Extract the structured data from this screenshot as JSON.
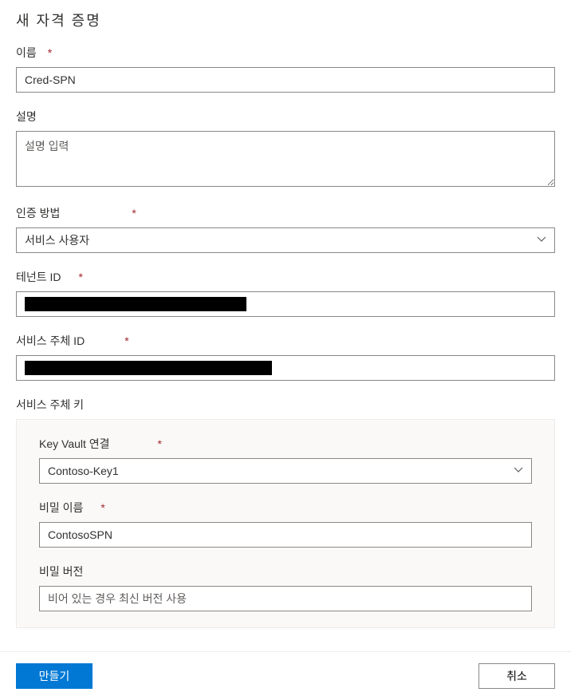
{
  "page": {
    "title": "새 자격 증명"
  },
  "fields": {
    "name": {
      "label": "이름",
      "value": "Cred-SPN",
      "required": true
    },
    "description": {
      "label": "설명",
      "placeholder": "설명 입력",
      "value": ""
    },
    "auth_method": {
      "label": "인증 방법",
      "value": "서비스 사용자",
      "required": true
    },
    "tenant_id": {
      "label": "테넌트 ID",
      "required": true,
      "redacted": true
    },
    "sp_id": {
      "label": "서비스 주체 ID",
      "required": true,
      "redacted": true
    },
    "sp_key": {
      "section_label": "서비스 주체 키",
      "kv_connection": {
        "label": "Key Vault 연결",
        "value": "Contoso-Key1",
        "required": true
      },
      "secret_name": {
        "label": "비밀 이름",
        "value": "ContosoSPN",
        "required": true
      },
      "secret_version": {
        "label": "비밀 버전",
        "placeholder": "비어 있는 경우 최신 버전 사용",
        "value": ""
      }
    }
  },
  "footer": {
    "create": "만들기",
    "cancel": "취소"
  },
  "required_marker": "*"
}
